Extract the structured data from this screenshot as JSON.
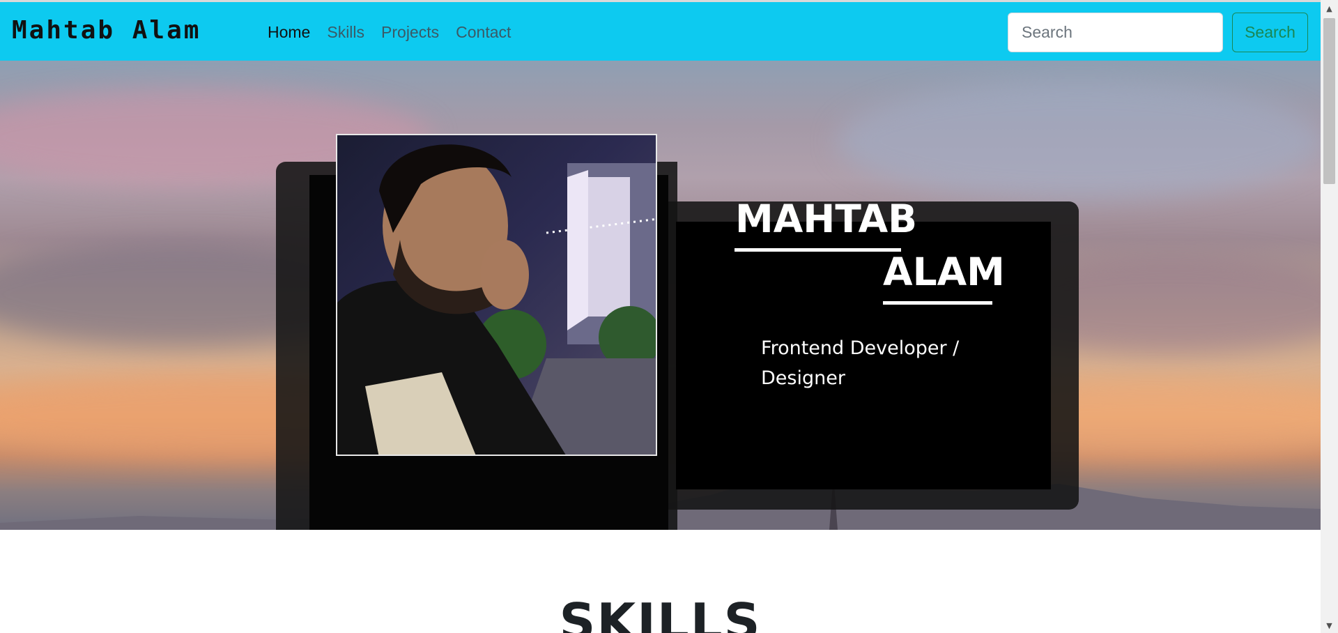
{
  "navbar": {
    "brand": "Mahtab Alam",
    "links": [
      {
        "label": "Home",
        "active": true
      },
      {
        "label": "Skills",
        "active": false
      },
      {
        "label": "Projects",
        "active": false
      },
      {
        "label": "Contact",
        "active": false
      }
    ],
    "search_placeholder": "Search",
    "search_button": "Search"
  },
  "hero": {
    "first_name": "MAHTAB",
    "last_name": "ALAM",
    "role": "Frontend Developer / Designer"
  },
  "skills": {
    "heading": "SKILLS"
  },
  "scrollbar": {
    "up_icon": "arrow-up-icon",
    "down_icon": "arrow-down-icon"
  },
  "colors": {
    "navbar_bg": "#0dcaf0",
    "search_button": "#198754"
  }
}
